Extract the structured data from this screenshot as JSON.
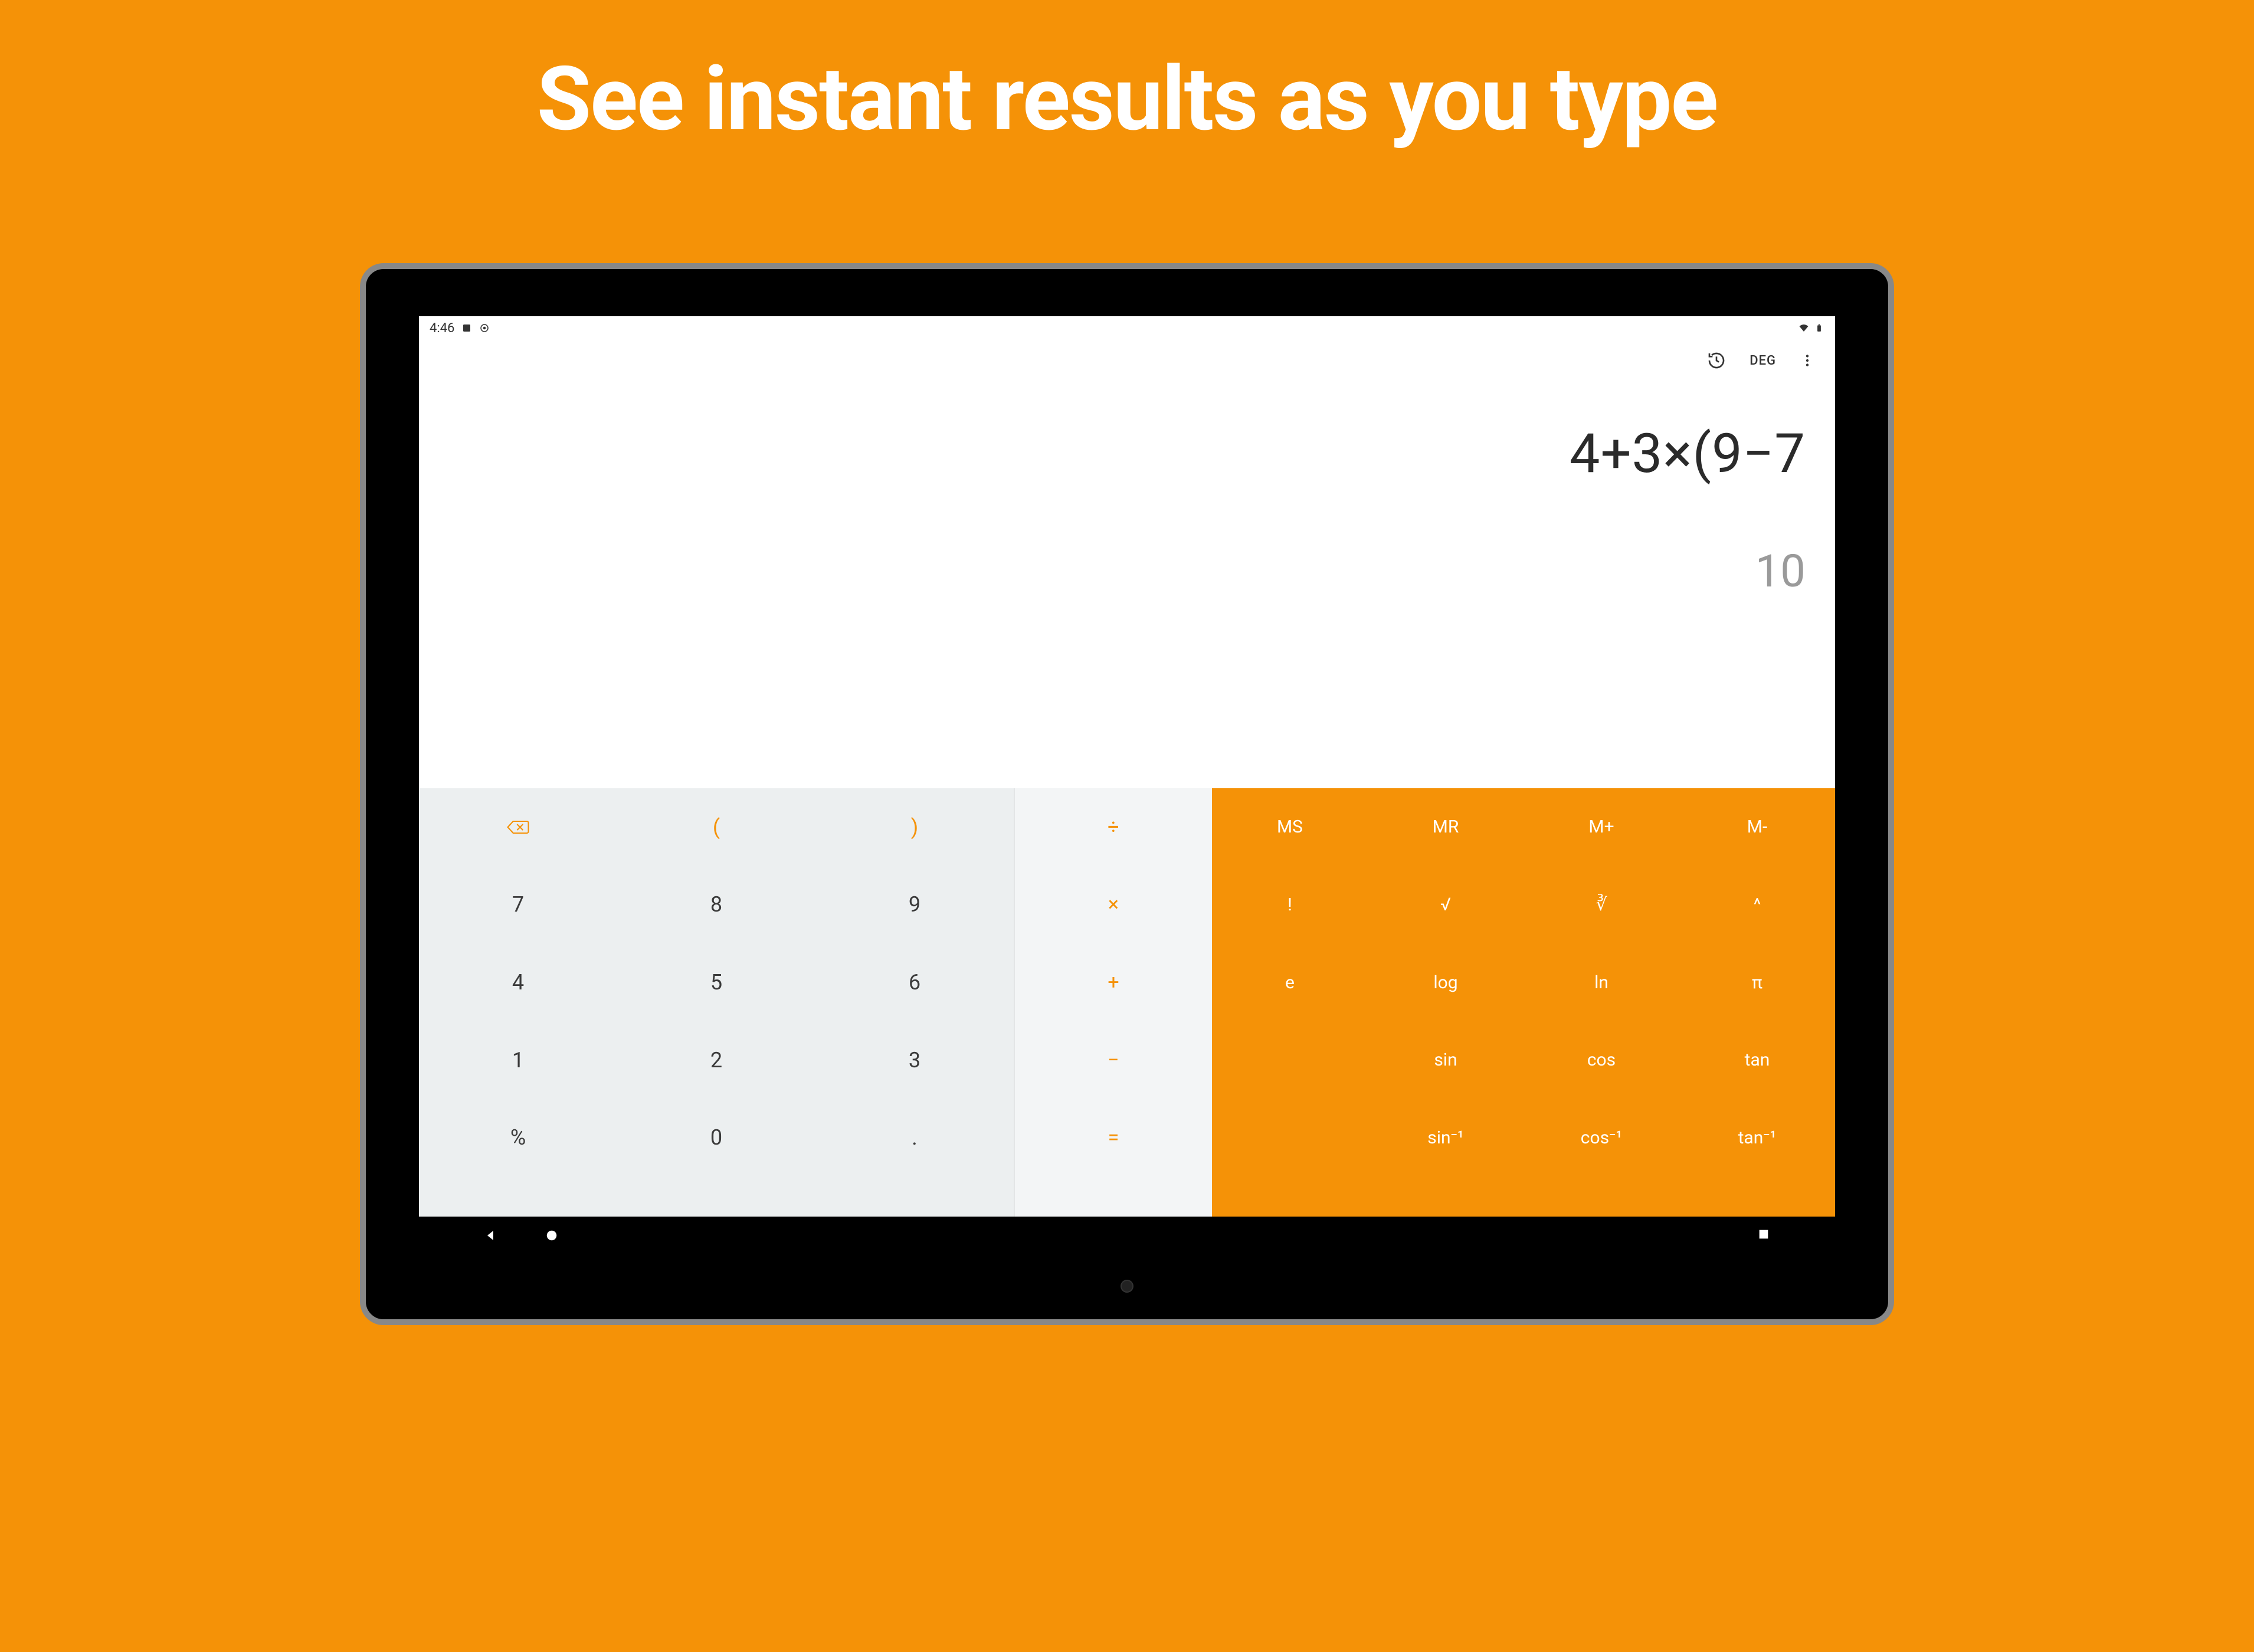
{
  "headline": "See instant results as you type",
  "status_bar": {
    "time": "4:46"
  },
  "toolbar": {
    "angle_mode": "DEG"
  },
  "display": {
    "expression": "4+3×(9−7",
    "result": "10"
  },
  "keypad": {
    "numeric": {
      "row0": {
        "paren_open": "(",
        "paren_close": ")"
      },
      "row1": {
        "k7": "7",
        "k8": "8",
        "k9": "9"
      },
      "row2": {
        "k4": "4",
        "k5": "5",
        "k6": "6"
      },
      "row3": {
        "k1": "1",
        "k2": "2",
        "k3": "3"
      },
      "row4": {
        "percent": "%",
        "k0": "0",
        "dot": "."
      }
    },
    "ops": {
      "divide": "÷",
      "multiply": "×",
      "plus": "+",
      "minus": "−",
      "equals": "="
    },
    "sci": {
      "r0": {
        "ms": "MS",
        "mr": "MR",
        "mplus": "M+",
        "mminus": "M-"
      },
      "r1": {
        "fact": "!",
        "sqrt": "√",
        "cbrt": "∛",
        "pow": "^"
      },
      "r2": {
        "e": "e",
        "log": "log",
        "ln": "ln",
        "pi": "π"
      },
      "r3": {
        "sin": "sin",
        "cos": "cos",
        "tan": "tan"
      },
      "r4": {
        "asin": "sin⁻¹",
        "acos": "cos⁻¹",
        "atan": "tan⁻¹"
      }
    }
  }
}
